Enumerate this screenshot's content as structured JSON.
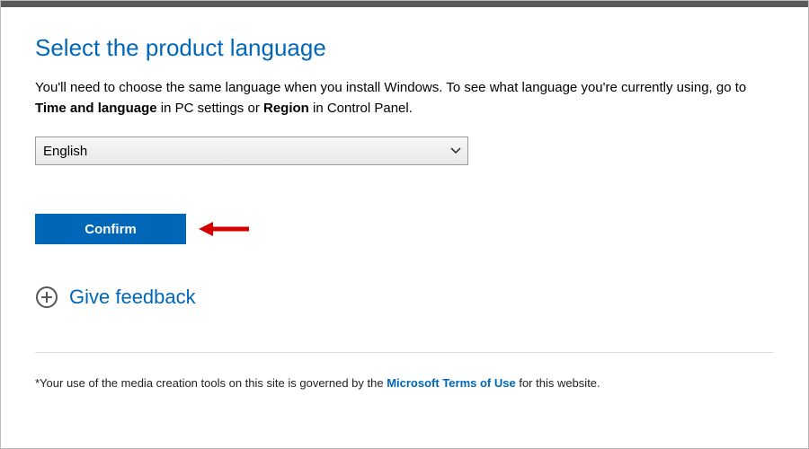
{
  "heading": "Select the product language",
  "desc": {
    "part1": "You'll need to choose the same language when you install Windows. To see what language you're currently using, go to ",
    "bold1": "Time and language",
    "part2": " in PC settings or ",
    "bold2": "Region",
    "part3": " in Control Panel."
  },
  "language_select": {
    "selected": "English"
  },
  "confirm_label": "Confirm",
  "feedback_label": "Give feedback",
  "footer": {
    "prefix": "*Your use of the media creation tools on this site is governed by the ",
    "link": "Microsoft Terms of Use",
    "suffix": " for this website."
  }
}
